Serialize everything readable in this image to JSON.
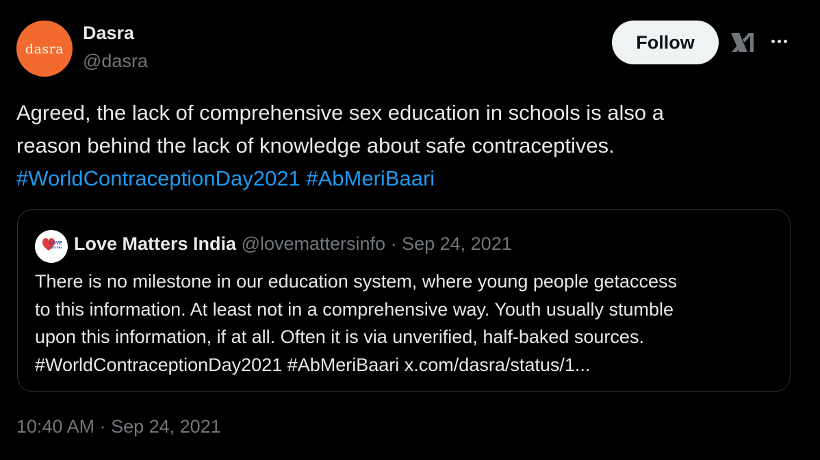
{
  "author": {
    "display_name": "Dasra",
    "handle": "@dasra",
    "avatar_text": "dasra",
    "avatar_color": "#f26a2e"
  },
  "actions": {
    "follow_label": "Follow",
    "grok_icon": "grok-icon",
    "more_icon": "more-options-icon"
  },
  "tweet": {
    "lines": [
      "Agreed, the lack of comprehensive sex education in schools is also a",
      "reason behind the lack of knowledge about safe contraceptives."
    ],
    "hashtags": [
      "#WorldContraceptionDay2021",
      "#AbMeriBaari"
    ]
  },
  "quoted": {
    "name": "Love Matters India",
    "handle": "@lovemattersinfo",
    "separator": " · ",
    "date": "Sep 24, 2021",
    "avatar_text_top": "LOVE",
    "avatar_text_bottom": "MATTERS",
    "lines": [
      "There is no milestone in our education system, where young people getaccess",
      "to this information. At least not in a comprehensive way. Youth usually stumble",
      "upon this information, if at all. Often it is via unverified, half-baked sources.",
      "#WorldContraceptionDay2021 #AbMeriBaari x.com/dasra/status/1..."
    ]
  },
  "timestamp": {
    "time": "10:40 AM",
    "separator": " · ",
    "date": "Sep 24, 2021"
  },
  "colors": {
    "background": "#000000",
    "text": "#e7e9ea",
    "muted": "#71767b",
    "link": "#1d9bf0",
    "border": "#2f3336"
  }
}
